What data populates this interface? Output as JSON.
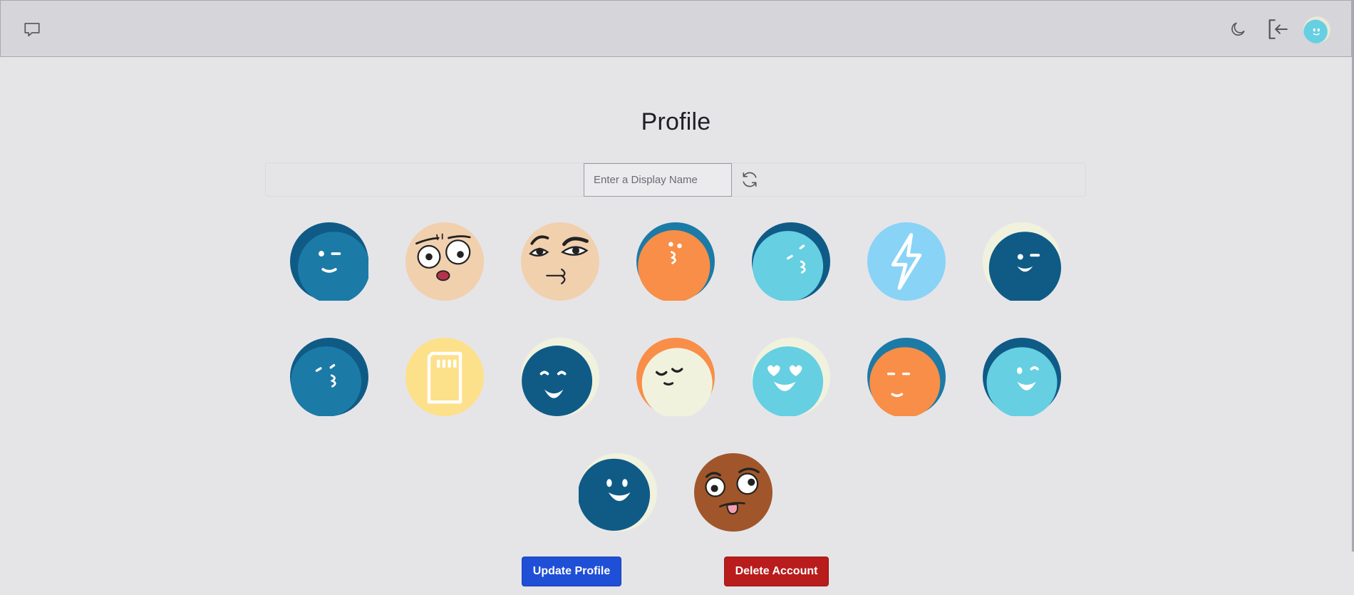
{
  "topbar": {
    "chat_icon": "chat-bubble-icon",
    "theme_icon": "moon-icon",
    "logout_icon": "logout-icon",
    "user_avatar": "cyan-smile-avatar"
  },
  "profile": {
    "title": "Profile",
    "display_name": {
      "value": "",
      "placeholder": "Enter a Display Name"
    },
    "refresh_icon": "refresh-icon",
    "avatars": [
      {
        "name": "teal-wink",
        "bg": "#1c7aa6"
      },
      {
        "name": "tan-worried",
        "bg": "#f1d0ae"
      },
      {
        "name": "tan-smirk",
        "bg": "#f1d0ae"
      },
      {
        "name": "orange-kiss",
        "bg": "#f88e47"
      },
      {
        "name": "cyan-kiss",
        "bg": "#66cfe2"
      },
      {
        "name": "lightning-bolt",
        "bg": "#89d3f7"
      },
      {
        "name": "navy-wink",
        "bg": "#0f5b86"
      },
      {
        "name": "teal-kiss",
        "bg": "#1c7aa6"
      },
      {
        "name": "sd-card",
        "bg": "#fde08a"
      },
      {
        "name": "navy-grin",
        "bg": "#0f5b86"
      },
      {
        "name": "cream-content",
        "bg": "#f1f2de"
      },
      {
        "name": "cyan-heart-eyes",
        "bg": "#66cfe2"
      },
      {
        "name": "orange-smile",
        "bg": "#f88e47"
      },
      {
        "name": "cyan-grin",
        "bg": "#66cfe2"
      },
      {
        "name": "navy-smile",
        "bg": "#0f5b86"
      },
      {
        "name": "brown-tongue",
        "bg": "#a0562a"
      }
    ]
  },
  "actions": {
    "update_label": "Update Profile",
    "delete_label": "Delete Account"
  },
  "colors": {
    "update": "#1f4fd6",
    "delete": "#b91c1c",
    "navy": "#0f5b86",
    "teal": "#1c7aa6",
    "cyan": "#66cfe2",
    "orange": "#f88e47",
    "cream": "#f1f2de",
    "tan": "#f1d0ae"
  }
}
